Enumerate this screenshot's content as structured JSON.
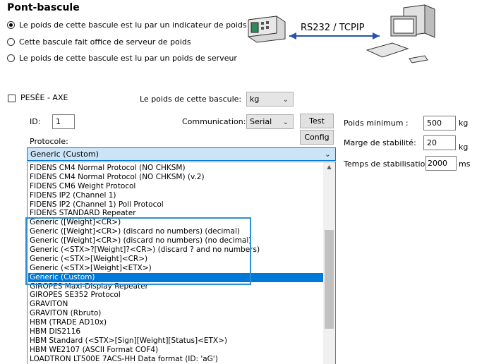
{
  "title": "Pont-bascule",
  "options": [
    {
      "label": "Le poids de cette bascule est lu par un indicateur de poids",
      "checked": true
    },
    {
      "label": "Cette bascule fait office de serveur de poids",
      "checked": false
    },
    {
      "label": "Le poids de cette bascule est lu par un poids de serveur",
      "checked": false
    }
  ],
  "diagram": {
    "link_label": "RS232 / TCPIP"
  },
  "axle": {
    "label": "PESÉE - AXE",
    "checked": false
  },
  "weight_unit": {
    "label": "Le poids de cette bascule:",
    "value": "kg"
  },
  "id_field": {
    "label": "ID:",
    "value": "1"
  },
  "communication": {
    "label": "Communication:",
    "value": "Serial",
    "test_label": "Test",
    "config_label": "Config"
  },
  "protocol": {
    "label": "Protocole:",
    "selected": "Generic (Custom)",
    "items": [
      "FIDENS CM4 Normal Protocol (NO CHKSM)",
      "FIDENS CM4 Normal Protocol (NO CHKSM) (v.2)",
      "FIDENS CM6 Weight Protocol",
      "FIDENS IP2 (Channel 1)",
      "FIDENS IP2 (Channel 1) Poll Protocol",
      "FIDENS STANDARD Repeater",
      "Generic ([Weight]<CR>)",
      "Generic ([Weight]<CR>) (discard no numbers) (decimal)",
      "Generic ([Weight]<CR>) (discard no numbers) (no decimal)",
      "Generic (<STX>?[Weight]?<CR>) (discard ? and no numbers)",
      "Generic (<STX>[Weight]<CR>)",
      "Generic (<STX>[Weight]<ETX>)",
      "Generic (Custom)",
      "GIROPES Maxi-Display Repeater",
      "GIROPES SE352 Protocol",
      "GRAVITON",
      "GRAVITON (Rbruto)",
      "HBM (TRADE AD10x)",
      "HBM DIS2116",
      "HBM Standard (<STX>[Sign][Weight][Status]<ETX>)",
      "HBM WE2107 (ASCII Format COF4)",
      "LOADTRON LT500E 7ACS-HH Data format (ID: 'aG')"
    ],
    "selected_index": 12
  },
  "min_weight": {
    "label": "Poids minimum :",
    "value": "500",
    "unit": "kg"
  },
  "stability_margin": {
    "label": "Marge de stabilité:",
    "value": "20",
    "unit": "kg"
  },
  "stabilization_time": {
    "label": "Temps de stabilisation",
    "value": "2000",
    "unit": "ms"
  }
}
